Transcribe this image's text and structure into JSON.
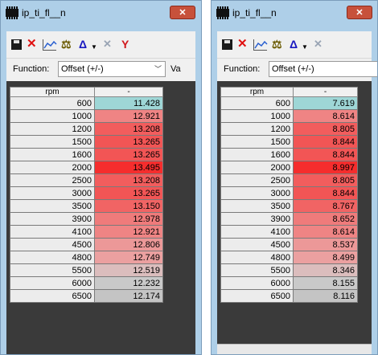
{
  "windows": [
    {
      "title": "ip_ti_fl__n",
      "close": "✕",
      "function_label": "Function:",
      "function_value": "Offset (+/-)",
      "function_extra": "Va",
      "header": {
        "rpm": "rpm",
        "value": "-"
      },
      "rows": [
        {
          "rpm": "600",
          "value": "11.428",
          "color": "#9ed6d6"
        },
        {
          "rpm": "1000",
          "value": "12.921",
          "color": "#ef8484"
        },
        {
          "rpm": "1200",
          "value": "13.208",
          "color": "#f25d5d"
        },
        {
          "rpm": "1500",
          "value": "13.265",
          "color": "#f25555"
        },
        {
          "rpm": "1600",
          "value": "13.265",
          "color": "#f25555"
        },
        {
          "rpm": "2000",
          "value": "13.495",
          "color": "#f52d2d"
        },
        {
          "rpm": "2500",
          "value": "13.208",
          "color": "#f25d5d"
        },
        {
          "rpm": "3000",
          "value": "13.265",
          "color": "#f25555"
        },
        {
          "rpm": "3500",
          "value": "13.150",
          "color": "#f16464"
        },
        {
          "rpm": "3900",
          "value": "12.978",
          "color": "#ef7b7b"
        },
        {
          "rpm": "4100",
          "value": "12.921",
          "color": "#ef8484"
        },
        {
          "rpm": "4500",
          "value": "12.806",
          "color": "#ec9898"
        },
        {
          "rpm": "4800",
          "value": "12.749",
          "color": "#eba0a0"
        },
        {
          "rpm": "5500",
          "value": "12.519",
          "color": "#dbbdbd"
        },
        {
          "rpm": "6000",
          "value": "12.232",
          "color": "#c9c9c9"
        },
        {
          "rpm": "6500",
          "value": "12.174",
          "color": "#c4c4c4"
        }
      ]
    },
    {
      "title": "ip_ti_fl__n",
      "close": "✕",
      "function_label": "Function:",
      "function_value": "Offset (+/-)",
      "header": {
        "rpm": "rpm",
        "value": "-"
      },
      "rows": [
        {
          "rpm": "600",
          "value": "7.619",
          "color": "#9ed6d6"
        },
        {
          "rpm": "1000",
          "value": "8.614",
          "color": "#ef8484"
        },
        {
          "rpm": "1200",
          "value": "8.805",
          "color": "#f25d5d"
        },
        {
          "rpm": "1500",
          "value": "8.844",
          "color": "#f25555"
        },
        {
          "rpm": "1600",
          "value": "8.844",
          "color": "#f25555"
        },
        {
          "rpm": "2000",
          "value": "8.997",
          "color": "#f52d2d"
        },
        {
          "rpm": "2500",
          "value": "8.805",
          "color": "#f25d5d"
        },
        {
          "rpm": "3000",
          "value": "8.844",
          "color": "#f25555"
        },
        {
          "rpm": "3500",
          "value": "8.767",
          "color": "#f16464"
        },
        {
          "rpm": "3900",
          "value": "8.652",
          "color": "#ef7b7b"
        },
        {
          "rpm": "4100",
          "value": "8.614",
          "color": "#ef8484"
        },
        {
          "rpm": "4500",
          "value": "8.537",
          "color": "#ec9898"
        },
        {
          "rpm": "4800",
          "value": "8.499",
          "color": "#eba0a0"
        },
        {
          "rpm": "5500",
          "value": "8.346",
          "color": "#dbbdbd"
        },
        {
          "rpm": "6000",
          "value": "8.155",
          "color": "#c9c9c9"
        },
        {
          "rpm": "6500",
          "value": "8.116",
          "color": "#c4c4c4"
        }
      ]
    }
  ],
  "toolbar_icons": [
    "save-icon",
    "delete-icon",
    "chart-icon",
    "scale-icon",
    "delta-icon",
    "dropdown-icon",
    "clear-x-icon",
    "y-axis-icon"
  ]
}
